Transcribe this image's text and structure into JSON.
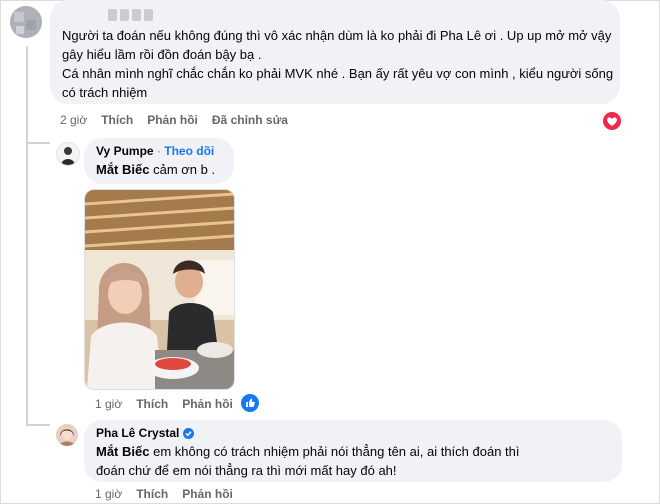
{
  "comment1": {
    "paragraphs": [
      "Người ta đoán nếu không đúng thì vô xác nhận dùm là ko phải đi Pha Lê ơi . Up up mở mở vậy gây hiểu lầm rồi đồn đoán bậy bạ .",
      "Cá nhân mình nghĩ chắc chắn ko phải MVK nhé . Bạn ấy rất yêu vợ con mình , kiểu người sống có trách nhiệm"
    ],
    "time": "2 giờ",
    "like": "Thích",
    "reply": "Phản hồi",
    "edited": "Đã chỉnh sửa",
    "reaction_icon": "heart-icon"
  },
  "reply1": {
    "name": "Vy Pumpe",
    "separator": "·",
    "follow": "Theo dõi",
    "tag": "Mắt Biếc",
    "text": "cảm ơn b .",
    "time": "1 giờ",
    "like": "Thích",
    "reply": "Phản hồi",
    "reaction_icon": "thumbs-up-icon"
  },
  "reply2": {
    "name": "Pha Lê Crystal",
    "verified_icon": "verified-badge-icon",
    "tag": "Mắt Biếc",
    "text": "em không có trách nhiệm phải nói thẳng tên ai, ai thích đoán thì đoán chứ để em nói thẳng ra thì mới mất hay đó ah!",
    "time": "1 giờ",
    "like": "Thích",
    "reply": "Phản hồi"
  },
  "colors": {
    "bubble": "#f0f2f5",
    "meta": "#65676b",
    "link": "#1877f2",
    "heart": "#f02849",
    "like": "#1877f2"
  }
}
